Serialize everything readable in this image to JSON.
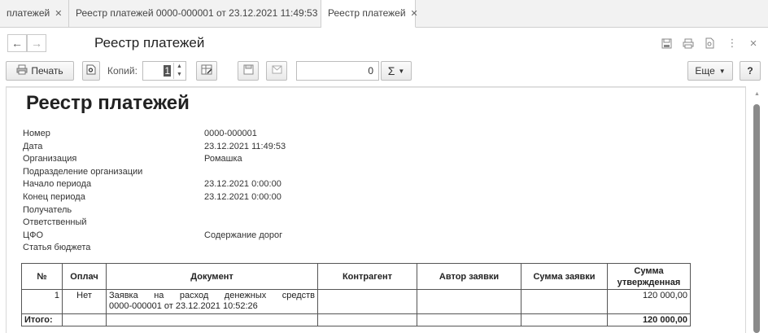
{
  "tabs": [
    {
      "label": "платежей",
      "closable": true,
      "active": false
    },
    {
      "label": "Реестр платежей 0000-000001 от 23.12.2021 11:49:53",
      "closable": true,
      "active": false
    },
    {
      "label": "Реестр платежей",
      "closable": true,
      "active": true
    }
  ],
  "header": {
    "back_icon": "←",
    "forward_icon": "→",
    "title": "Реестр платежей",
    "more_icon": "⋮",
    "close_icon": "×"
  },
  "toolbar": {
    "print_label": "Печать",
    "copies_label": "Копий:",
    "copies_value": "1",
    "sum_value": "0",
    "sigma_label": "Σ",
    "more_label": "Еще",
    "help_label": "?"
  },
  "document": {
    "title": "Реестр платежей",
    "info": [
      {
        "key": "Номер",
        "value": "0000-000001"
      },
      {
        "key": "Дата",
        "value": "23.12.2021 11:49:53"
      },
      {
        "key": "Организация",
        "value": "Ромашка"
      },
      {
        "key": "Подразделение организации",
        "value": ""
      },
      {
        "key": "Начало периода",
        "value": "23.12.2021 0:00:00"
      },
      {
        "key": "Конец периода",
        "value": "23.12.2021 0:00:00"
      },
      {
        "key": "Получатель",
        "value": ""
      },
      {
        "key": "Ответственный",
        "value": ""
      },
      {
        "key": "ЦФО",
        "value": "Содержание дорог"
      },
      {
        "key": "Статья бюджета",
        "value": ""
      }
    ],
    "table": {
      "headers": [
        "№",
        "Оплач",
        "Документ",
        "Контрагент",
        "Автор заявки",
        "Сумма заявки",
        "Сумма утвержденная"
      ],
      "rows": [
        {
          "num": "1",
          "paid": "Нет",
          "doc_line1": "Заявка на расход денежных средств",
          "doc_line2": "0000-000001 от 23.12.2021 10:52:26",
          "contractor": "",
          "author": "",
          "sum_request": "",
          "sum_approved": "120 000,00"
        }
      ],
      "total_label": "Итого:",
      "total_value": "120 000,00"
    }
  }
}
